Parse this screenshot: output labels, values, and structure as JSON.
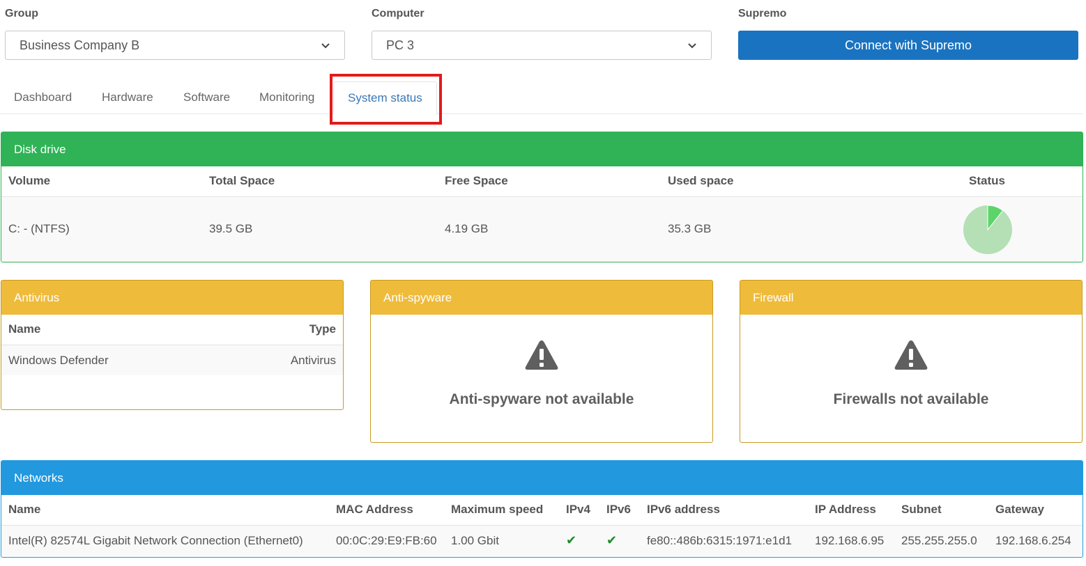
{
  "selectors": {
    "group": {
      "label": "Group",
      "value": "Business Company B"
    },
    "computer": {
      "label": "Computer",
      "value": "PC 3"
    },
    "supremo": {
      "label": "Supremo",
      "button": "Connect with Supremo"
    }
  },
  "tabs": [
    "Dashboard",
    "Hardware",
    "Software",
    "Monitoring",
    "System status"
  ],
  "disk": {
    "title": "Disk drive",
    "headers": {
      "volume": "Volume",
      "total": "Total Space",
      "free": "Free Space",
      "used": "Used space",
      "status": "Status"
    },
    "row": {
      "volume": "C: - (NTFS)",
      "total": "39.5 GB",
      "free": "4.19 GB",
      "used": "35.3 GB"
    },
    "pie": {
      "free_fraction": 0.106,
      "free_color": "#5cd46a",
      "used_color": "#b5dfb5"
    }
  },
  "antivirus": {
    "title": "Antivirus",
    "headers": {
      "name": "Name",
      "type": "Type"
    },
    "row": {
      "name": "Windows Defender",
      "type": "Antivirus"
    }
  },
  "antispyware": {
    "title": "Anti-spyware",
    "message": "Anti-spyware not available",
    "icon": "warning-icon"
  },
  "firewall": {
    "title": "Firewall",
    "message": "Firewalls not available",
    "icon": "warning-icon"
  },
  "networks": {
    "title": "Networks",
    "headers": {
      "name": "Name",
      "mac": "MAC Address",
      "speed": "Maximum speed",
      "ipv4": "IPv4",
      "ipv6": "IPv6",
      "ipv6addr": "IPv6 address",
      "ip": "IP Address",
      "subnet": "Subnet",
      "gateway": "Gateway"
    },
    "row": {
      "name": "Intel(R) 82574L Gigabit Network Connection (Ethernet0)",
      "mac": "00:0C:29:E9:FB:60",
      "speed": "1.00 Gbit",
      "ipv4": "✔",
      "ipv6": "✔",
      "ipv6addr": "fe80::486b:6315:1971:e1d1",
      "ip": "192.168.6.95",
      "subnet": "255.255.255.0",
      "gateway": "192.168.6.254"
    }
  },
  "colors": {
    "primary": "#1a73c0",
    "success": "#2fb356",
    "warning": "#efbb3b",
    "info": "#2298de",
    "highlight": "#e21b1b"
  }
}
